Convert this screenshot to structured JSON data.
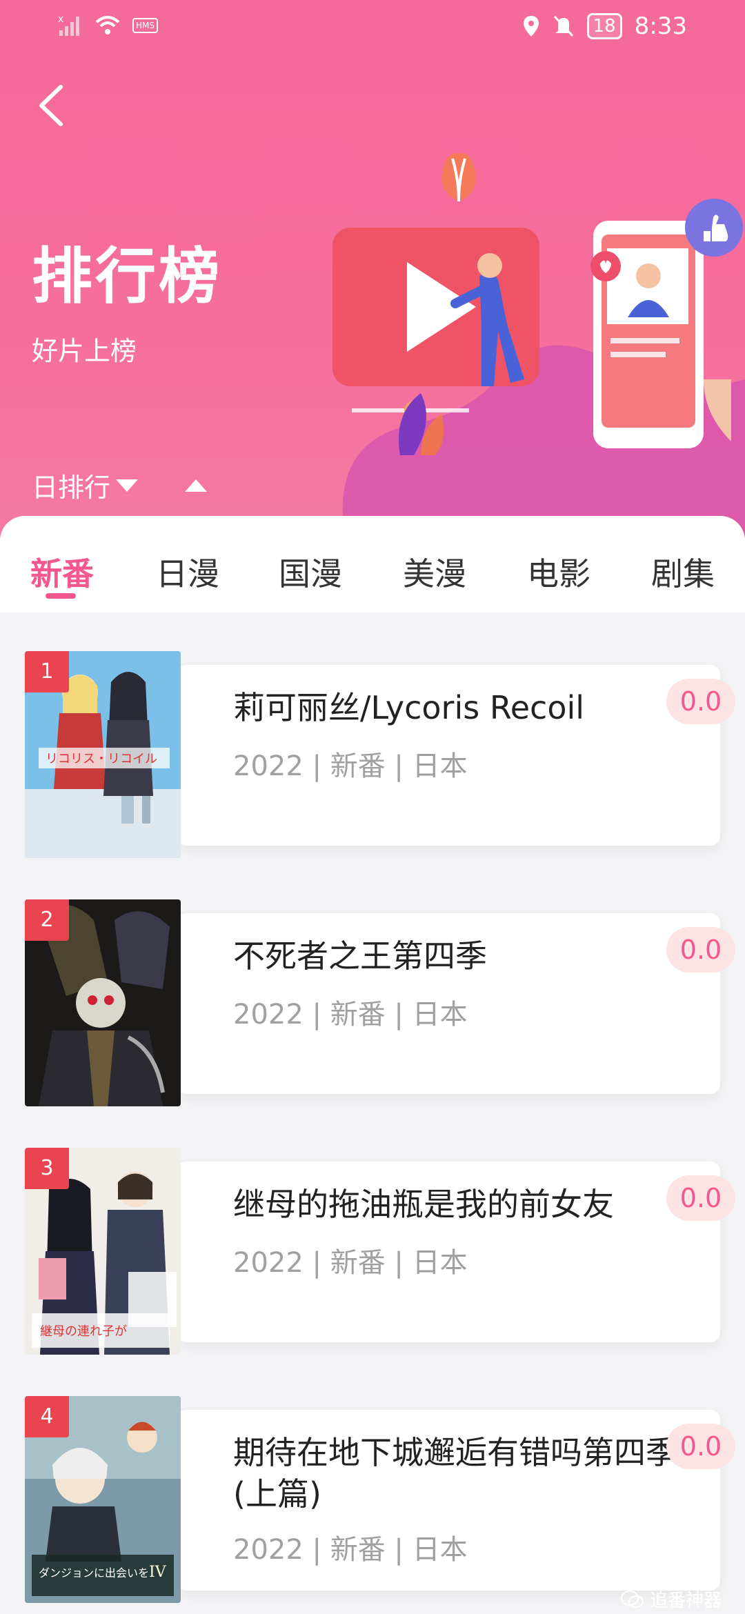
{
  "status_bar": {
    "time": "8:33",
    "battery": "18",
    "hms": "HMS"
  },
  "header": {
    "title": "排行榜",
    "subtitle": "好片上榜",
    "sort_label": "日排行"
  },
  "tabs": [
    "新番",
    "日漫",
    "国漫",
    "美漫",
    "电影",
    "剧集"
  ],
  "active_tab": "新番",
  "items": [
    {
      "rank": "1",
      "title": "莉可丽丝/Lycoris Recoil",
      "meta": "2022 | 新番 | 日本",
      "score": "0.0"
    },
    {
      "rank": "2",
      "title": "不死者之王第四季",
      "meta": "2022 | 新番 | 日本",
      "score": "0.0"
    },
    {
      "rank": "3",
      "title": "继母的拖油瓶是我的前女友",
      "meta": "2022 | 新番 | 日本",
      "score": "0.0"
    },
    {
      "rank": "4",
      "title": "期待在地下城邂逅有错吗第四季(上篇)",
      "meta": "2022 | 新番 | 日本",
      "score": "0.0"
    }
  ],
  "watermark": "追番神器",
  "colors": {
    "accent": "#f3578f",
    "header_bg": "#f46a9b",
    "rank_badge": "#e9444f"
  }
}
